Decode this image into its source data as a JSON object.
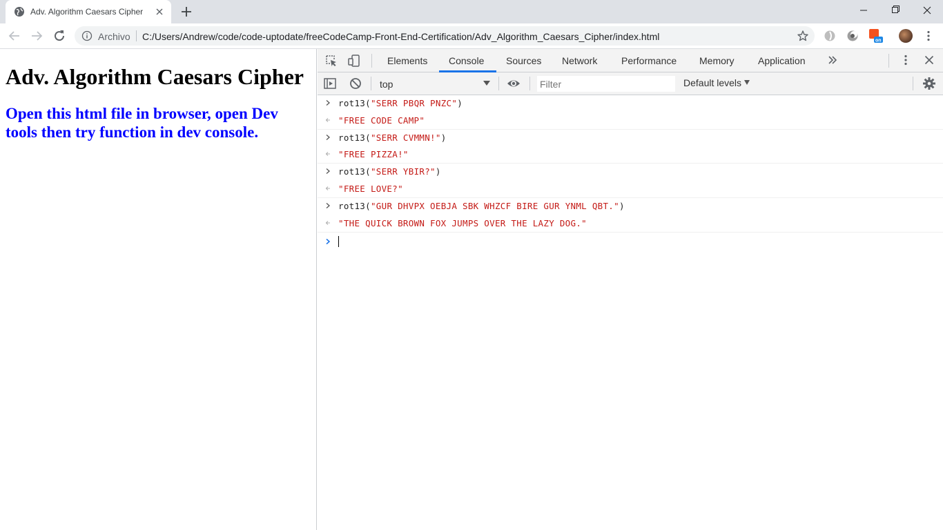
{
  "browser": {
    "tab_title": "Adv. Algorithm Caesars Cipher",
    "omnibox": {
      "scheme_label": "Archivo",
      "url": "C:/Users/Andrew/code/code-uptodate/freeCodeCamp-Front-End-Certification/Adv_Algorithm_Caesars_Cipher/index.html"
    }
  },
  "page": {
    "heading": "Adv. Algorithm Caesars Cipher",
    "subheading": "Open this html file in browser, open Dev tools then try function in dev console."
  },
  "devtools": {
    "tabs": [
      {
        "label": "Elements",
        "active": false
      },
      {
        "label": "Console",
        "active": true
      },
      {
        "label": "Sources",
        "active": false
      },
      {
        "label": "Network",
        "active": false
      },
      {
        "label": "Performance",
        "active": false
      },
      {
        "label": "Memory",
        "active": false
      },
      {
        "label": "Application",
        "active": false
      }
    ],
    "context": "top",
    "filter_placeholder": "Filter",
    "levels_label": "Default levels",
    "accent_color": "#1a73e8",
    "string_color": "#c41a16"
  },
  "console": {
    "entries": [
      {
        "fn": "rot13(",
        "arg": "\"SERR PBQR PNZC\"",
        "close": ")",
        "result": "\"FREE CODE CAMP\""
      },
      {
        "fn": "rot13(",
        "arg": "\"SERR CVMMN!\"",
        "close": ")",
        "result": "\"FREE PIZZA!\""
      },
      {
        "fn": "rot13(",
        "arg": "\"SERR YBIR?\"",
        "close": ")",
        "result": "\"FREE LOVE?\""
      },
      {
        "fn": "rot13(",
        "arg": "\"GUR DHVPX OEBJA SBK WHZCF BIRE GUR YNML QBT.\"",
        "close": ")",
        "result": "\"THE QUICK BROWN FOX JUMPS OVER THE LAZY DOG.\""
      }
    ]
  }
}
